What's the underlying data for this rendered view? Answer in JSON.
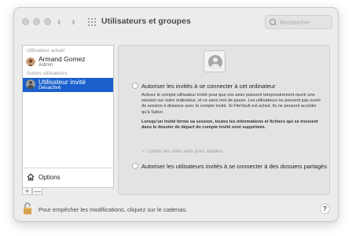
{
  "window": {
    "title": "Utilisateurs et groupes",
    "back_glyph": "‹",
    "forward_glyph": "›"
  },
  "search": {
    "placeholder": "Rechercher"
  },
  "sidebar": {
    "current_section": "Utilisateur actuel",
    "current_user": {
      "name": "Armand Gomez",
      "role": "Admin"
    },
    "other_section": "Autres utilisateurs",
    "other_users": [
      {
        "name": "Utilisateur invité",
        "status": "Désactivé",
        "selected": true
      }
    ],
    "options_label": "Options",
    "add_label": "+",
    "remove_label": "—"
  },
  "content": {
    "allow_login_label": "Autoriser les invités à se connecter à cet ordinateur",
    "description": "Activez le compte utilisateur invité pour que vos amis puissent temporairement ouvrir une session sur votre ordinateur, et ce sans mot de passe. Les utilisateurs ne peuvent pas ouvrir de session à distance avec le compte invité. Si FileVault est activé, ils ne peuvent accéder qu’à Safari.",
    "warning": "Lorsqu’un invité ferme sa session, toutes les informations et fichiers qui se trouvent dans le dossier de départ du compte invité sont supprimés.",
    "limit_sites_label": "Limiter les sites web pour adultes",
    "limit_sites_check": "✓",
    "allow_shared_label": "Autoriser les utilisateurs invités à se connecter à des dossiers partagés"
  },
  "bottom": {
    "lock_text": "Pour empêcher les modifications, cliquez sur le cadenas.",
    "help_label": "?"
  },
  "colors": {
    "accent": "#1a5fcc",
    "window_bg": "#ececec"
  },
  "icons": {
    "lock": "lock-icon",
    "home": "home-icon",
    "search": "search-icon",
    "guest_avatar": "guest-avatar-icon"
  }
}
